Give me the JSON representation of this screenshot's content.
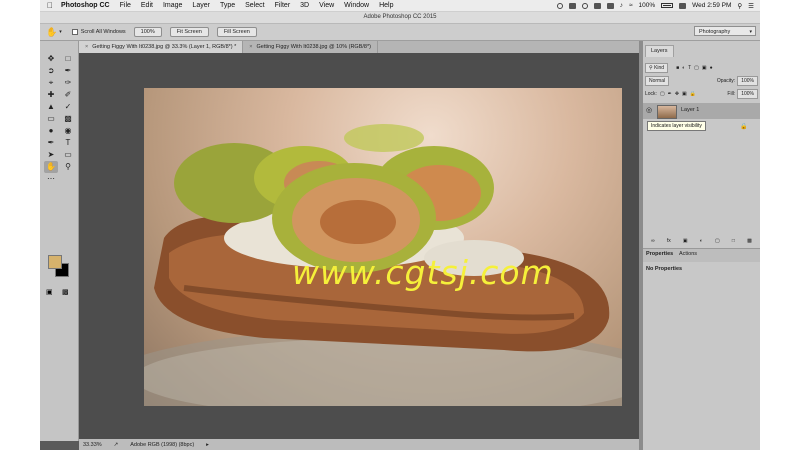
{
  "menubar": {
    "app_name": "Photoshop CC",
    "items": [
      "File",
      "Edit",
      "Image",
      "Layer",
      "Type",
      "Select",
      "Filter",
      "3D",
      "View",
      "Window",
      "Help"
    ],
    "battery": "100%",
    "clock": "Wed 2:59 PM"
  },
  "window": {
    "title": "Adobe Photoshop CC 2015"
  },
  "options_bar": {
    "scroll_all_label": "Scroll All Windows",
    "btn_100": "100%",
    "btn_fit": "Fit Screen",
    "btn_fill": "Fill Screen",
    "workspace": "Photography"
  },
  "tabs": [
    {
      "label": "Getting Figgy With It0238.jpg @ 33.3% (Layer 1, RGB/8*) *"
    },
    {
      "label": "Getting Figgy With It0238.jpg @ 10% (RGB/8*)"
    }
  ],
  "status": {
    "zoom": "33.33%",
    "profile": "Adobe RGB (1998) (8bpc)"
  },
  "photo": {
    "watermark": "www.cgtsj.com"
  },
  "layers_panel": {
    "tab": "Layers",
    "kind": "Kind",
    "blend_mode": "Normal",
    "opacity_label": "Opacity:",
    "opacity_value": "100%",
    "lock_label": "Lock:",
    "fill_label": "Fill:",
    "fill_value": "100%",
    "layer_name": "Layer 1",
    "tooltip": "Indicates layer visibility"
  },
  "properties_panel": {
    "tab_properties": "Properties",
    "tab_actions": "Actions",
    "empty_text": "No Properties"
  },
  "colors": {
    "foreground": "#d6b26c",
    "background": "#000000",
    "watermark": "#f5f03a"
  }
}
